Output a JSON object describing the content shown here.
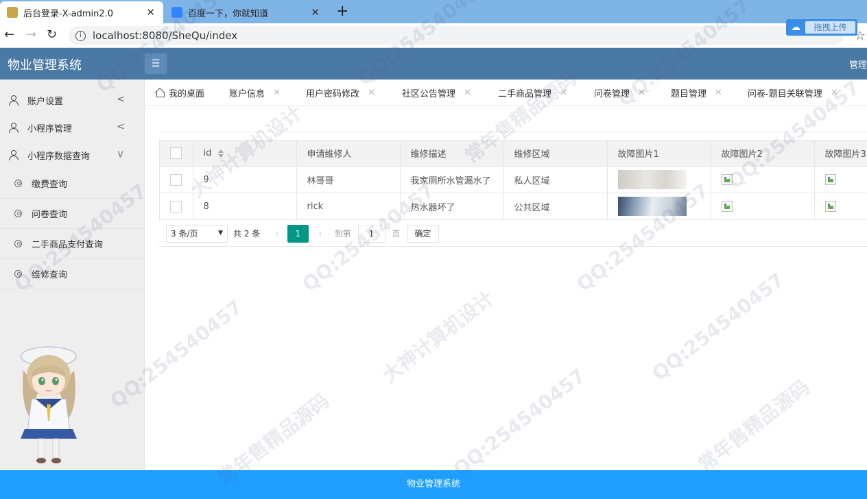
{
  "browser": {
    "tabs": [
      {
        "title": "后台登录-X-admin2.0",
        "active": true
      },
      {
        "title": "百度一下，你就知道",
        "active": false
      }
    ],
    "url": "localhost:8080/SheQu/index",
    "extension_label": "拖拽上传"
  },
  "header": {
    "title": "物业管理系统",
    "right_text": "管理"
  },
  "sidebar": {
    "items": [
      {
        "label": "账户设置",
        "expanded": false
      },
      {
        "label": "小程序管理",
        "expanded": false
      },
      {
        "label": "小程序数据查询",
        "expanded": true
      }
    ],
    "subitems": [
      {
        "label": "缴费查询"
      },
      {
        "label": "问卷查询"
      },
      {
        "label": "二手商品支付查询"
      },
      {
        "label": "维修查询"
      }
    ]
  },
  "page_tabs": [
    {
      "label": "我的桌面"
    },
    {
      "label": "账户信息"
    },
    {
      "label": "用户密码修改"
    },
    {
      "label": "社区公告管理"
    },
    {
      "label": "二手商品管理"
    },
    {
      "label": "问卷管理"
    },
    {
      "label": "题目管理"
    },
    {
      "label": "问卷-题目关联管理"
    }
  ],
  "table": {
    "columns": [
      "id",
      "申请维修人",
      "维修描述",
      "维修区域",
      "故障图片1",
      "故障图片2",
      "故障图片3"
    ],
    "rows": [
      {
        "id": "9",
        "applicant": "林哥哥",
        "description": "我家厕所水管漏水了",
        "area": "私人区域"
      },
      {
        "id": "8",
        "applicant": "rick",
        "description": "热水器坏了",
        "area": "公共区域"
      }
    ]
  },
  "pagination": {
    "per_page": "3 条/页",
    "total": "共 2 条",
    "current_page": "1",
    "goto_label": "到第",
    "goto_value": "1",
    "page_unit": "页",
    "confirm_label": "确定"
  },
  "footer": {
    "text": "物业管理系统"
  },
  "watermark": {
    "lines": [
      "QQ:254540457",
      "大神计算机设计",
      "常年售精品源码"
    ]
  },
  "colors": {
    "header_bg": "#4b79a5",
    "footer_bg": "#1e9fff",
    "pager_active": "#009688",
    "sidebar_bg": "#eeeeee"
  }
}
